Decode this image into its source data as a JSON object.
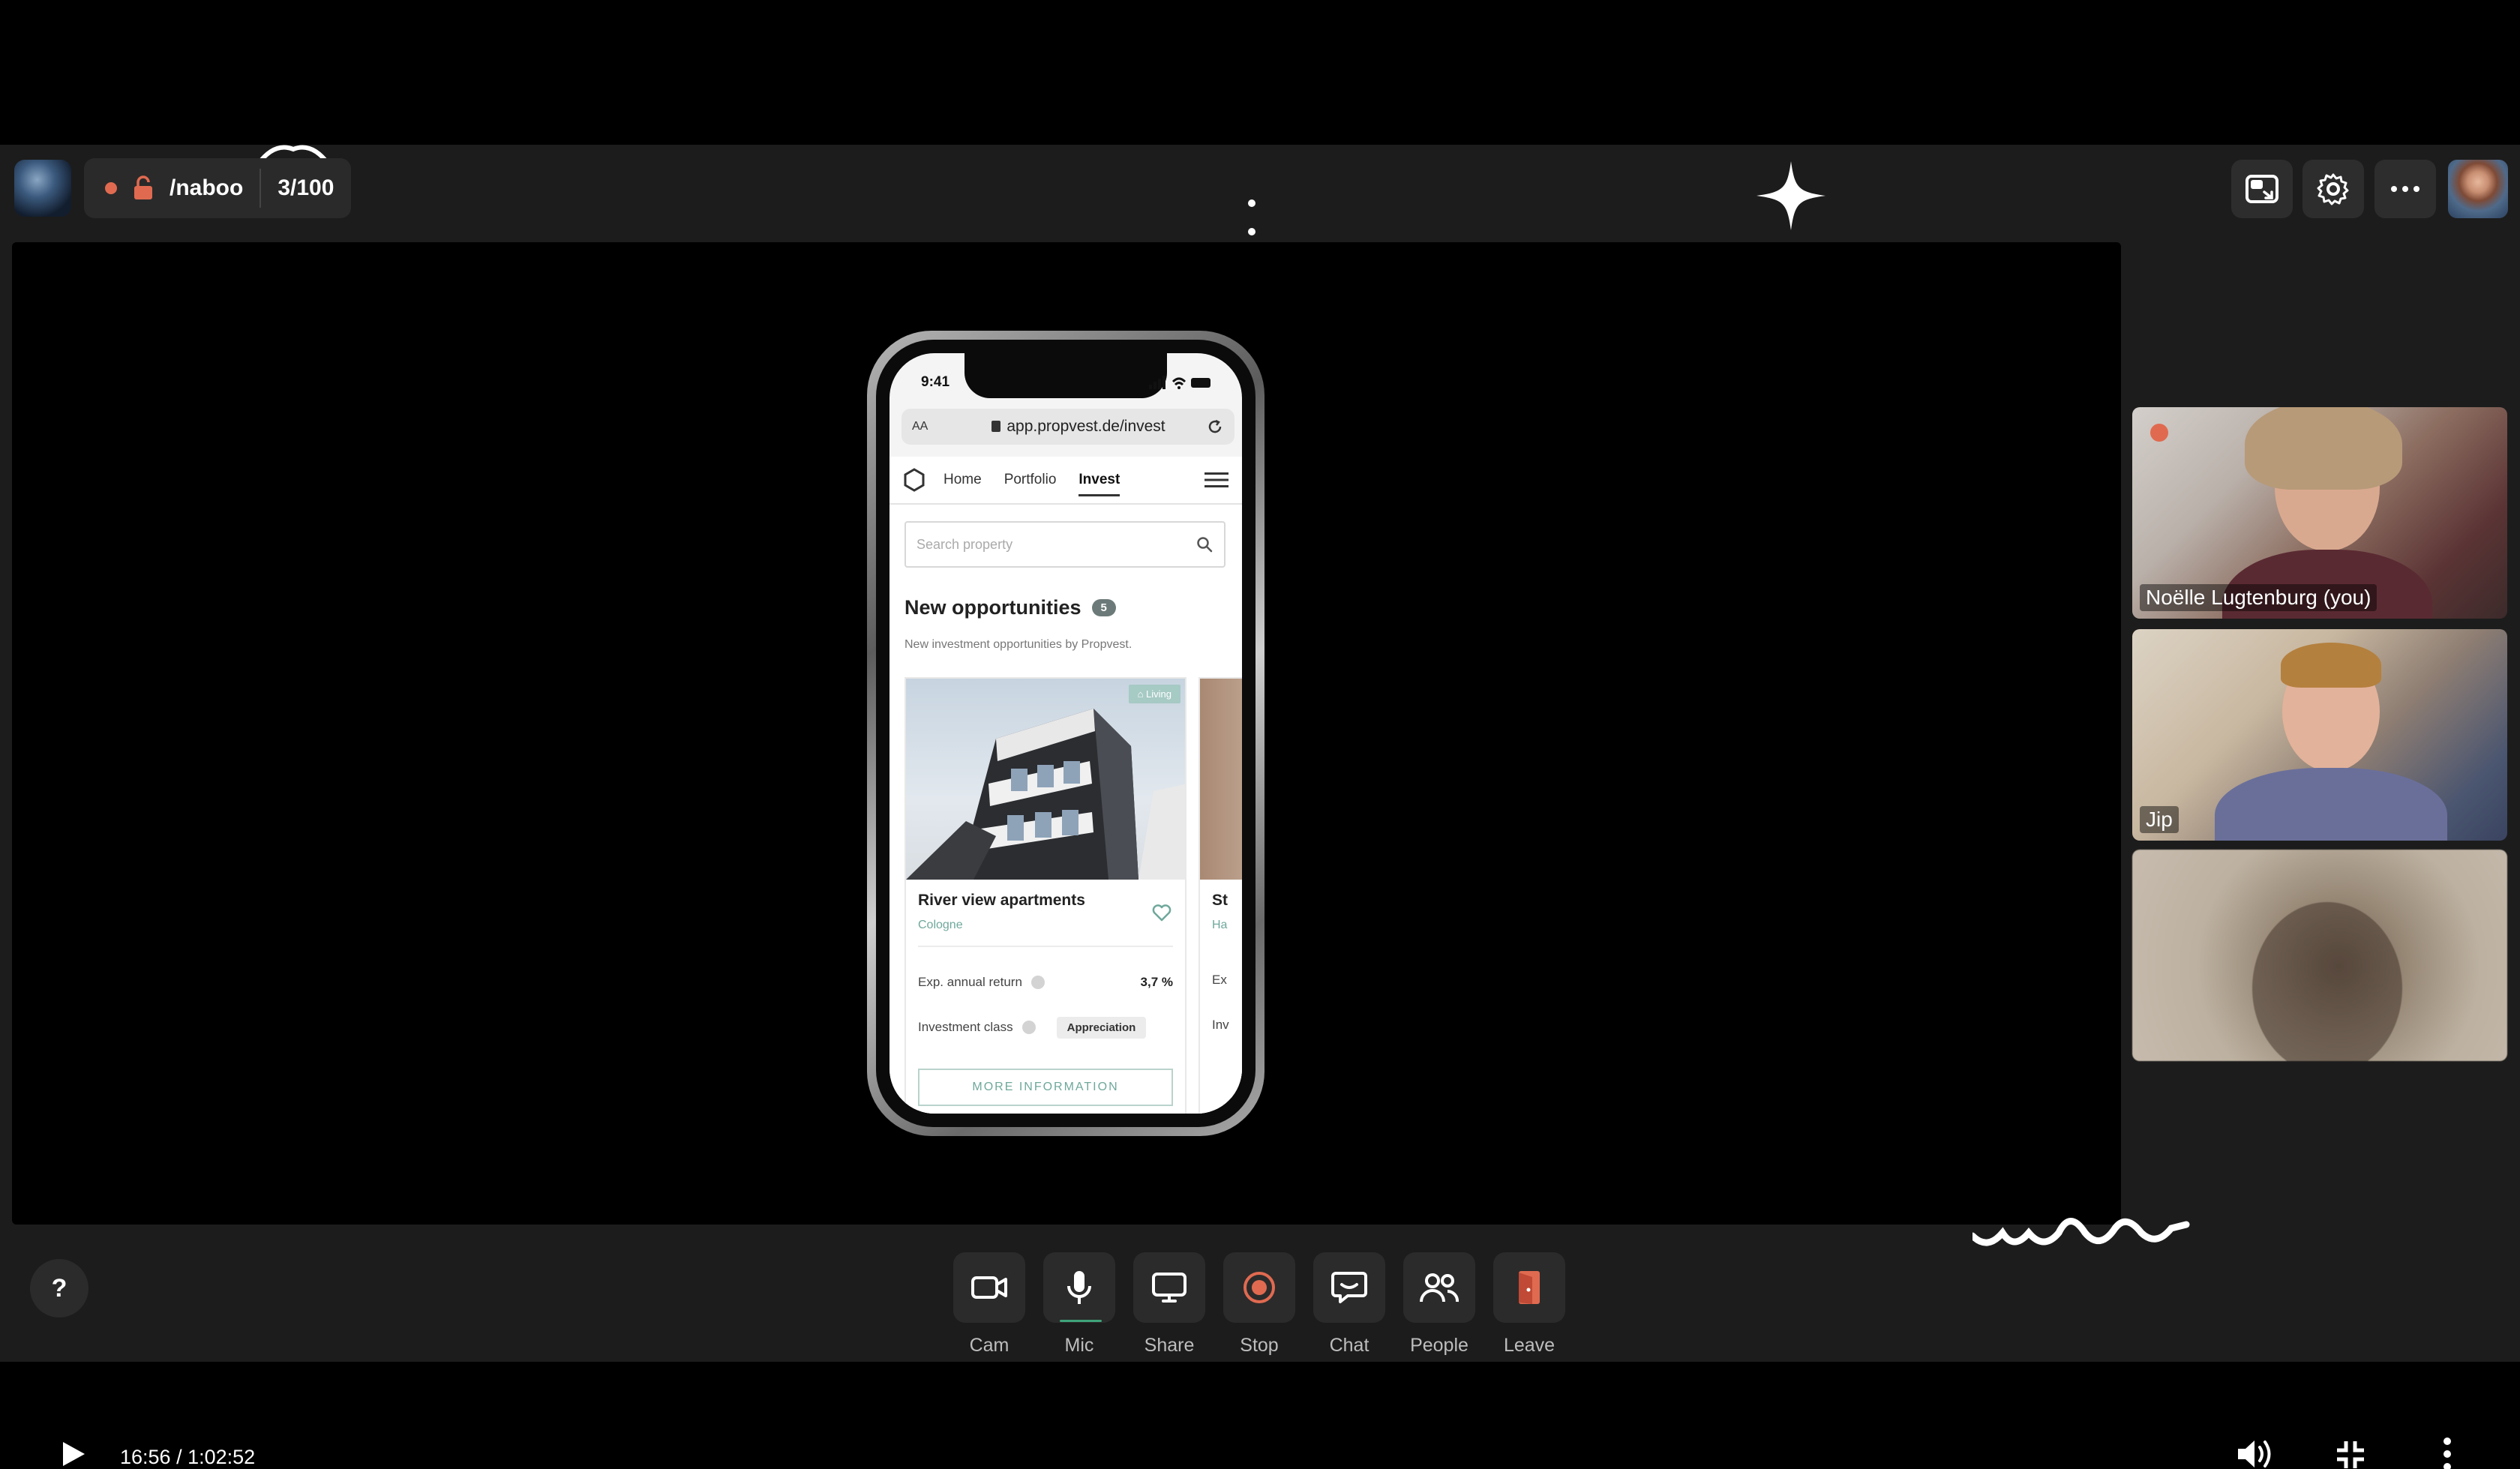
{
  "topbar": {
    "room_name": "/naboo",
    "room_count": "3/100",
    "buttons": [
      {
        "name": "picture-in-picture",
        "icon": "pip-icon"
      },
      {
        "name": "settings",
        "icon": "gear-icon"
      },
      {
        "name": "more",
        "icon": "more-horizontal-icon"
      }
    ]
  },
  "phone": {
    "status_time": "9:41",
    "url_aa": "AA",
    "url": "app.propvest.de/invest",
    "nav": {
      "home": "Home",
      "portfolio": "Portfolio",
      "invest": "Invest"
    },
    "search_placeholder": "Search property",
    "section_title": "New opportunities",
    "section_count": "5",
    "section_sub": "New investment opportunities by Propvest.",
    "card": {
      "tag": "Living",
      "title": "River view apartments",
      "city": "Cologne",
      "return_label": "Exp. annual return",
      "return_value": "3,7 %",
      "class_label": "Investment class",
      "class_value": "Appreciation",
      "button": "MORE INFORMATION"
    },
    "card2": {
      "title": "St",
      "city": "Ha",
      "return_label": "Ex",
      "class_label": "Inv"
    }
  },
  "participants": [
    {
      "name": "Noëlle Lugtenburg (you)"
    },
    {
      "name": "Jip"
    },
    {
      "name": ""
    }
  ],
  "controls": {
    "help": "?",
    "cam": "Cam",
    "mic": "Mic",
    "share": "Share",
    "stop": "Stop",
    "chat": "Chat",
    "people": "People",
    "leave": "Leave"
  },
  "player": {
    "time": "16:56 / 1:02:52"
  },
  "colors": {
    "record": "#e06a50",
    "accent_green": "#3fa37a",
    "brand_teal": "#6fa89b"
  }
}
